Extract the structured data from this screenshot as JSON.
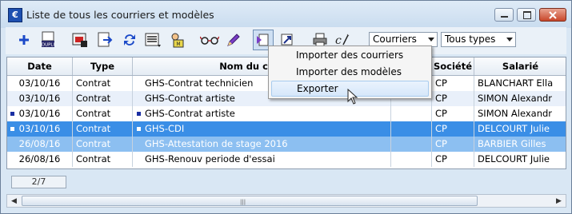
{
  "window": {
    "title": "Liste de tous les courriers et modèles",
    "app_icon_glyph": "€"
  },
  "toolbar": {
    "icons": [
      "add-icon",
      "duplicate-icon",
      "print-preview-icon",
      "export-file-icon",
      "refresh-icon",
      "list-icon",
      "mail-merge-icon",
      "glasses-icon",
      "pen-icon",
      "import-export-icon",
      "share-icon",
      "printer-icon",
      "signature-icon"
    ],
    "dropdown1": "Courriers",
    "dropdown2": "Tous types"
  },
  "table": {
    "columns": [
      "Date",
      "Type",
      "Nom du courrier",
      "",
      "Société",
      "Salarié"
    ],
    "rows": [
      {
        "date": "03/10/16",
        "type": "Contrat",
        "name": "GHS-Contrat technicien",
        "societe": "CP",
        "salarie": "BLANCHART Ella",
        "mark_left": false,
        "mark_name": false,
        "state": "normal"
      },
      {
        "date": "03/10/16",
        "type": "Contrat",
        "name": "GHS-Contrat artiste",
        "societe": "CP",
        "salarie": "SIMON Alexandr",
        "mark_left": false,
        "mark_name": false,
        "state": "alt"
      },
      {
        "date": "03/10/16",
        "type": "Contrat",
        "name": "GHS-Contrat artiste",
        "societe": "CP",
        "salarie": "SIMON Alexandr",
        "mark_left": true,
        "mark_name": true,
        "state": "normal"
      },
      {
        "date": "03/10/16",
        "type": "Contrat",
        "name": "GHS-CDI",
        "societe": "CP",
        "salarie": "DELCOURT Julie",
        "mark_left": true,
        "mark_name": true,
        "state": "selected"
      },
      {
        "date": "26/08/16",
        "type": "Contrat",
        "name": "GHS-Attestation de stage 2016",
        "societe": "CP",
        "salarie": "BARBIER Gilles",
        "mark_left": false,
        "mark_name": false,
        "state": "selected-light"
      },
      {
        "date": "26/08/16",
        "type": "Contrat",
        "name": "GHS-Renouv periode d'essai",
        "societe": "CP",
        "salarie": "DELCOURT Julie",
        "mark_left": false,
        "mark_name": false,
        "state": "normal"
      }
    ]
  },
  "footer": {
    "counter": "2/7"
  },
  "menu": {
    "items": [
      "Importer des courriers",
      "Importer des modèles",
      "Exporter"
    ],
    "highlighted": 2
  },
  "colors": {
    "selection": "#3a8ee6",
    "selection_light": "#8cbff1",
    "marker": "#1a2fa3"
  }
}
